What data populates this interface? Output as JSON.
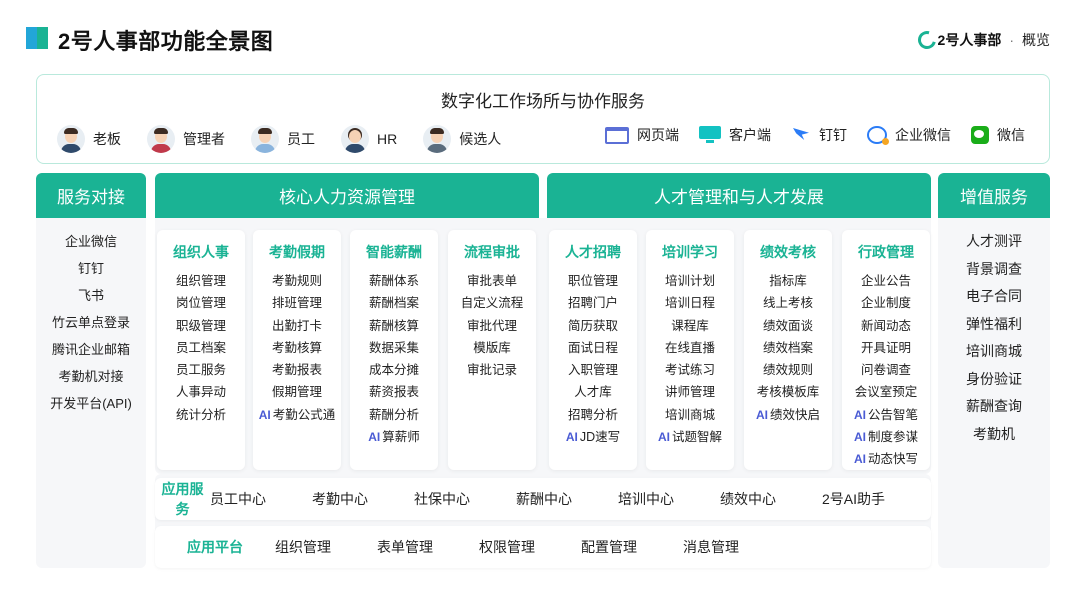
{
  "header": {
    "title": "2号人事部功能全景图",
    "brand_name": "2号人事部",
    "brand_sep": "·",
    "brand_sub": "概览"
  },
  "top": {
    "title": "数字化工作场所与协作服务",
    "roles": [
      "老板",
      "管理者",
      "员工",
      "HR",
      "候选人"
    ],
    "clients": [
      {
        "label": "网页端",
        "icon": "web-icon"
      },
      {
        "label": "客户端",
        "icon": "desktop-icon"
      },
      {
        "label": "钉钉",
        "icon": "dingtalk-icon"
      },
      {
        "label": "企业微信",
        "icon": "wecom-icon"
      },
      {
        "label": "微信",
        "icon": "wechat-icon"
      }
    ]
  },
  "columns": {
    "left": "服务对接",
    "core": "核心人力资源管理",
    "talent": "人才管理和与人才发展",
    "right": "增值服务"
  },
  "left_items": [
    "企业微信",
    "钉钉",
    "飞书",
    "竹云单点登录",
    "腾讯企业邮箱",
    "考勤机对接",
    "开发平台(API)"
  ],
  "right_items": [
    "人才测评",
    "背景调查",
    "电子合同",
    "弹性福利",
    "培训商城",
    "身份验证",
    "薪酬查询",
    "考勤机"
  ],
  "cards": [
    {
      "title": "组织人事",
      "items": [
        "组织管理",
        "岗位管理",
        "职级管理",
        "员工档案",
        "员工服务",
        "人事异动",
        "统计分析"
      ],
      "ai": []
    },
    {
      "title": "考勤假期",
      "items": [
        "考勤规则",
        "排班管理",
        "出勤打卡",
        "考勤核算",
        "考勤报表",
        "假期管理"
      ],
      "ai": [
        "考勤公式通"
      ]
    },
    {
      "title": "智能薪酬",
      "items": [
        "薪酬体系",
        "薪酬档案",
        "薪酬核算",
        "数据采集",
        "成本分摊",
        "薪资报表",
        "薪酬分析"
      ],
      "ai": [
        "算薪师"
      ]
    },
    {
      "title": "流程审批",
      "items": [
        "审批表单",
        "自定义流程",
        "审批代理",
        "模版库",
        "审批记录"
      ],
      "ai": []
    },
    {
      "title": "人才招聘",
      "items": [
        "职位管理",
        "招聘门户",
        "简历获取",
        "面试日程",
        "入职管理",
        "人才库",
        "招聘分析"
      ],
      "ai": [
        "JD速写"
      ]
    },
    {
      "title": "培训学习",
      "items": [
        "培训计划",
        "培训日程",
        "课程库",
        "在线直播",
        "考试练习",
        "讲师管理",
        "培训商城"
      ],
      "ai": [
        "试题智解"
      ]
    },
    {
      "title": "绩效考核",
      "items": [
        "指标库",
        "线上考核",
        "绩效面谈",
        "绩效档案",
        "绩效规则",
        "考核模板库"
      ],
      "ai": [
        "绩效快启"
      ]
    },
    {
      "title": "行政管理",
      "items": [
        "企业公告",
        "企业制度",
        "新闻动态",
        "开具证明",
        "问卷调查",
        "会议室预定"
      ],
      "ai": [
        "公告智笔",
        "制度参谋",
        "动态快写"
      ]
    }
  ],
  "ai_mark": "AI",
  "app_service": {
    "label": "应用服务",
    "items": [
      "员工中心",
      "考勤中心",
      "社保中心",
      "薪酬中心",
      "培训中心",
      "绩效中心",
      "2号AI助手"
    ]
  },
  "app_platform": {
    "label": "应用平台",
    "items": [
      "组织管理",
      "表单管理",
      "权限管理",
      "配置管理",
      "消息管理"
    ]
  }
}
